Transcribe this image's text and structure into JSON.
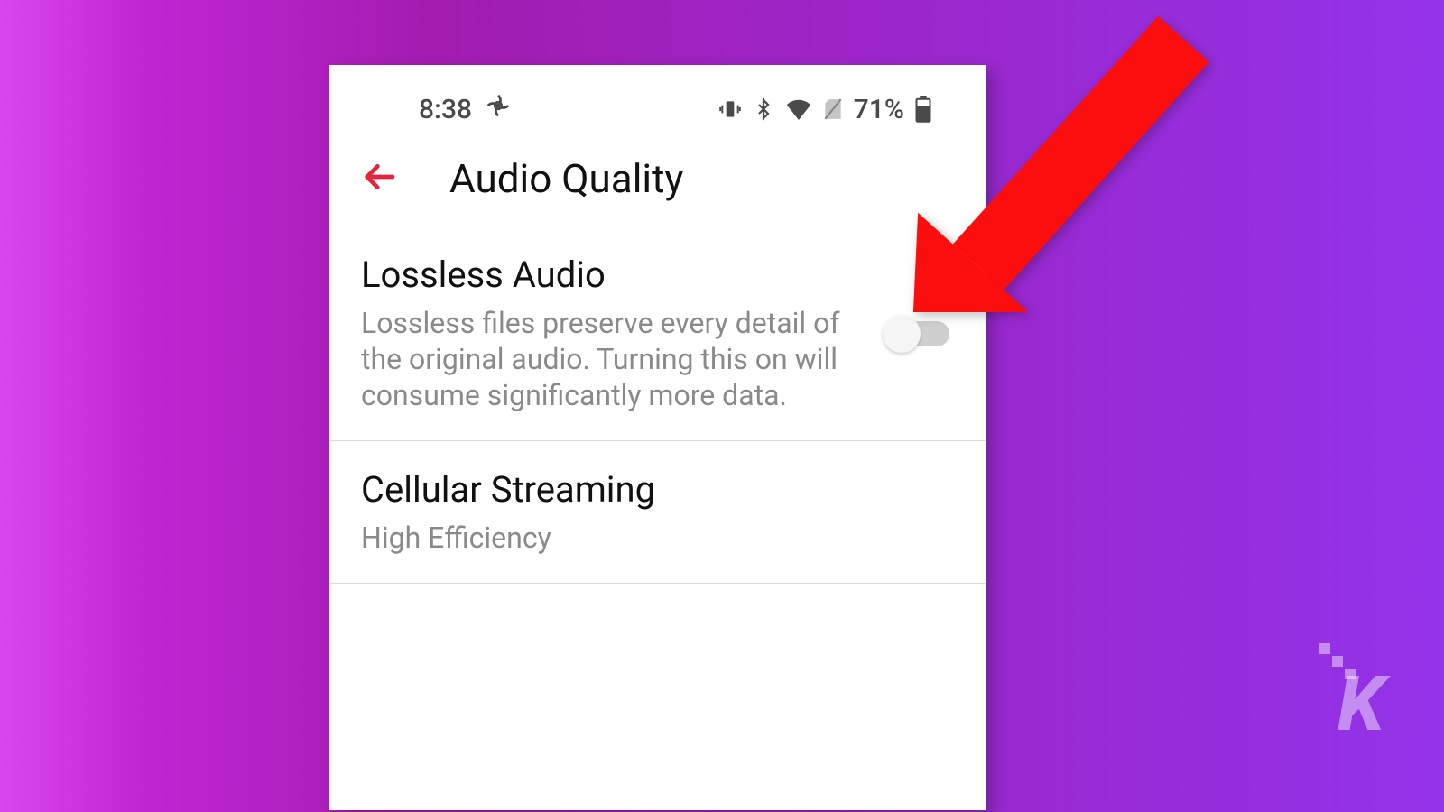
{
  "status_bar": {
    "time": "8:38",
    "battery_percent": "71%"
  },
  "header": {
    "title": "Audio Quality"
  },
  "settings": {
    "lossless": {
      "title": "Lossless Audio",
      "description": "Lossless files preserve every detail of the original audio. Turning this on will consume significantly more data.",
      "enabled": false
    },
    "cellular": {
      "title": "Cellular Streaming",
      "value": "High Efficiency"
    }
  },
  "watermark": "K"
}
